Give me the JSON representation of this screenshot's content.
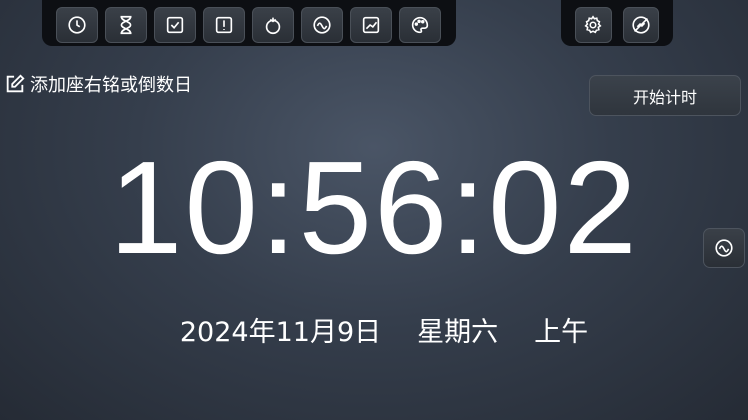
{
  "toolbar": {
    "left_icons": [
      "clock-icon",
      "hourglass-icon",
      "checklist-icon",
      "alert-icon",
      "tomato-icon",
      "wave-icon",
      "chart-icon",
      "palette-icon"
    ],
    "right_icons": [
      "gear-icon",
      "no-image-icon"
    ]
  },
  "motto": {
    "label": "添加座右铭或倒数日"
  },
  "start_button": {
    "label": "开始计时"
  },
  "clock": {
    "time": "10:56:02"
  },
  "date": {
    "date": "2024年11月9日",
    "weekday": "星期六",
    "period": "上午"
  },
  "side_button": {
    "icon": "wave-icon"
  }
}
